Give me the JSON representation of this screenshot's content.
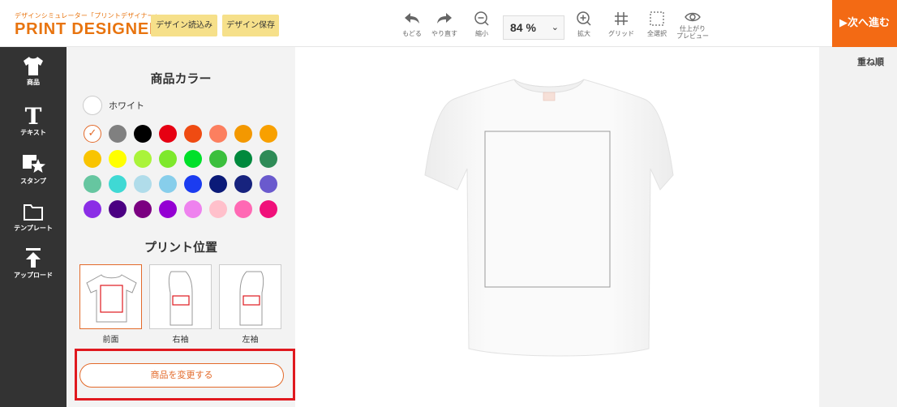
{
  "header": {
    "logo_sub": "デザインシミュレーター「プリントデザイナー」",
    "logo_main": "PRINT DESIGNER",
    "load_label": "デザイン読込み",
    "save_label": "デザイン保存",
    "undo_label": "もどる",
    "redo_label": "やり直す",
    "zoom_out_label": "縮小",
    "zoom_value": "84 %",
    "zoom_in_label": "拡大",
    "grid_label": "グリッド",
    "select_all_label": "全選択",
    "preview_label_1": "仕上がり",
    "preview_label_2": "プレビュー",
    "next_label": "▶次へ進む"
  },
  "sidebar": {
    "items": [
      {
        "label": "商品",
        "icon": "tshirt-icon"
      },
      {
        "label": "テキスト",
        "icon": "text-icon"
      },
      {
        "label": "スタンプ",
        "icon": "stamp-icon"
      },
      {
        "label": "テンプレート",
        "icon": "folder-icon"
      },
      {
        "label": "アップロード",
        "icon": "upload-icon"
      }
    ]
  },
  "panel": {
    "color_title": "商品カラー",
    "selected_color_name": "ホワイト",
    "colors": [
      "#ffffff",
      "#808080",
      "#000000",
      "#e60012",
      "#ef4b12",
      "#fc7f5f",
      "#f39800",
      "#f8a000",
      "#f9c400",
      "#ffff00",
      "#aaf33a",
      "#7ee82c",
      "#00e02a",
      "#3bbf3d",
      "#00893d",
      "#2e8b57",
      "#66c6a0",
      "#3fd9d4",
      "#b0dcea",
      "#87ceeb",
      "#1b3cf0",
      "#0b1a78",
      "#17237e",
      "#6a5acd",
      "#8b2ee6",
      "#4b0082",
      "#7b0081",
      "#9400d3",
      "#ee82ee",
      "#ffc0cb",
      "#ff69b4",
      "#f0107a"
    ],
    "position_title": "プリント位置",
    "positions": [
      {
        "label": "前面"
      },
      {
        "label": "右袖"
      },
      {
        "label": "左袖"
      }
    ],
    "change_product_label": "商品を変更する"
  },
  "right_panel": {
    "layer_title": "重ね順"
  },
  "colors": {
    "accent": "#f36a14",
    "highlight": "#e0191f",
    "sidebar_bg": "#333333"
  }
}
